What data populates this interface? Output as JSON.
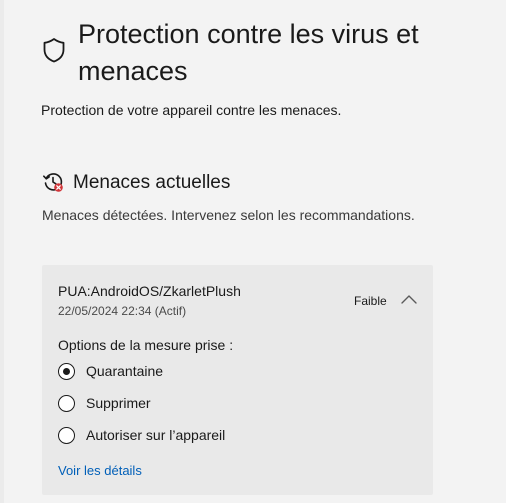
{
  "header": {
    "title": "Protection contre les virus et menaces",
    "subtitle": "Protection de votre appareil contre les menaces."
  },
  "section": {
    "title": "Menaces actuelles",
    "description": "Menaces détectées. Intervenez selon les recommandations."
  },
  "threat": {
    "name": "PUA:AndroidOS/ZkarletPlush",
    "date": "22/05/2024 22:34 (Actif)",
    "severity": "Faible",
    "options_label": "Options de la mesure prise :",
    "options": [
      {
        "label": "Quarantaine",
        "selected": true
      },
      {
        "label": "Supprimer",
        "selected": false
      },
      {
        "label": "Autoriser sur l’appareil",
        "selected": false
      }
    ],
    "details_link": "Voir les détails"
  },
  "icons": {
    "header": "shield-icon",
    "section": "threat-history-icon",
    "collapse": "chevron-up-icon"
  },
  "colors": {
    "background": "#f3f3f3",
    "card": "#e9e9e9",
    "link": "#005fb8",
    "alert": "#d13438"
  }
}
